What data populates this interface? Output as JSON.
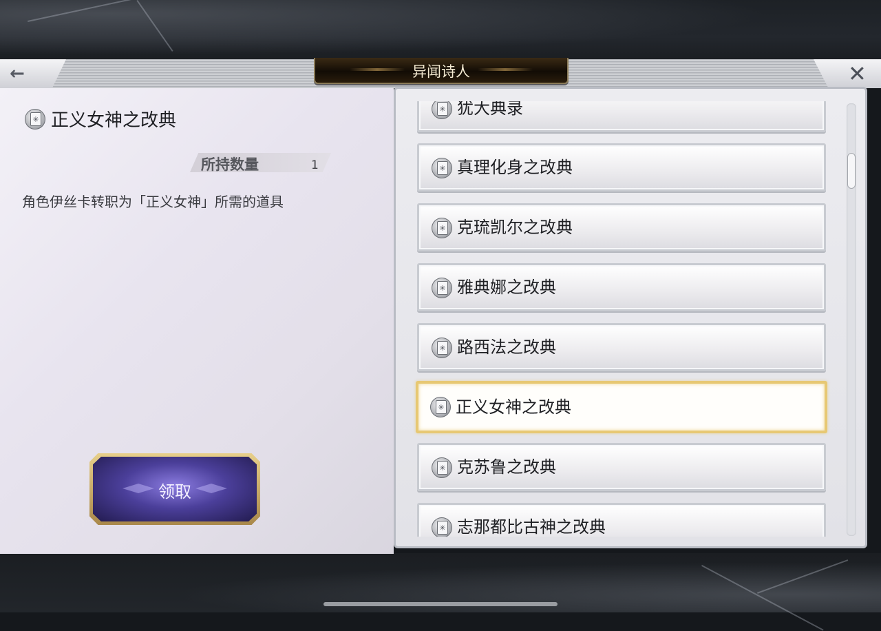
{
  "header": {
    "title": "异闻诗人",
    "back_icon": "←",
    "close_icon": "✕"
  },
  "detail": {
    "item_name": "正义女神之改典",
    "quantity_label": "所持数量",
    "quantity_value": "1",
    "description": "角色伊丝卡转职为「正义女神」所需的道具",
    "claim_label": "领取"
  },
  "list": {
    "items": [
      {
        "name": "犹大典录",
        "icon": "book-icon"
      },
      {
        "name": "真理化身之改典",
        "icon": "book-icon"
      },
      {
        "name": "克琉凯尔之改典",
        "icon": "book-icon"
      },
      {
        "name": "雅典娜之改典",
        "icon": "book-icon"
      },
      {
        "name": "路西法之改典",
        "icon": "book-icon"
      },
      {
        "name": "正义女神之改典",
        "icon": "book-icon",
        "selected": true
      },
      {
        "name": "克苏鲁之改典",
        "icon": "book-icon"
      },
      {
        "name": "志那都比古神之改典",
        "icon": "book-icon"
      }
    ],
    "selected_index": 5
  },
  "colors": {
    "selected_border": "#e7c873",
    "claim_button": "#4b3f9a",
    "title_plate": "#120c05"
  }
}
